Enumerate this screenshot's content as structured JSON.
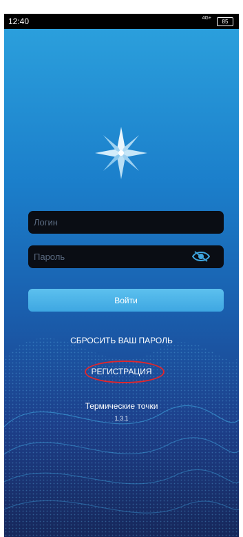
{
  "top_strip": {
    "text": "12:40 ...tiny fragment of device status"
  },
  "status_bar": {
    "time": "12:40",
    "signal": "4G+",
    "battery": "85"
  },
  "login_form": {
    "login_placeholder": "Логин",
    "password_placeholder": "Пароль",
    "login_button": "Войти"
  },
  "links": {
    "reset_password": "СБРОСИТЬ ВАШ ПАРОЛЬ",
    "registration": "РЕГИСТРАЦИЯ"
  },
  "app_info": {
    "name": "Термические точки",
    "version": "1.3.1"
  },
  "colors": {
    "background_top": "#2b9fdc",
    "background_bottom": "#16275a",
    "field_background": "#0a0d14",
    "button": "#3ea7e2",
    "annotation": "#e0262c"
  },
  "icons": {
    "logo": "compass-star-icon",
    "password_toggle": "eye-off-icon"
  }
}
